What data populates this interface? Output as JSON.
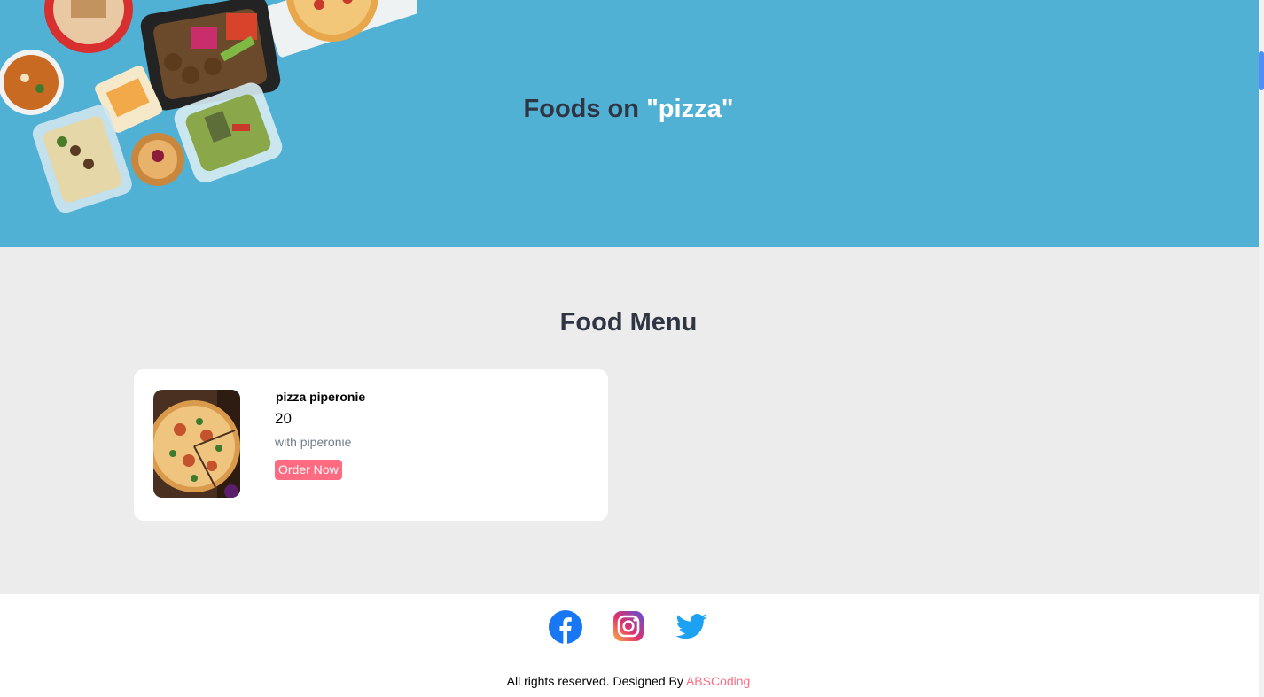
{
  "hero": {
    "title_prefix": "Foods on",
    "query": "\"pizza\""
  },
  "menu": {
    "title": "Food Menu",
    "items": [
      {
        "name": "pizza piperonie",
        "price": "20",
        "description": "with piperonie",
        "order_label": "Order Now"
      }
    ]
  },
  "footer": {
    "social_icons": [
      "facebook-icon",
      "instagram-icon",
      "twitter-icon"
    ],
    "copyright": "All rights reserved. Designed By",
    "designer": "ABSCoding"
  },
  "colors": {
    "hero_bg": "#51b1d4",
    "menu_bg": "#ececec",
    "accent": "#ff6b81",
    "heading": "#2f3542"
  }
}
